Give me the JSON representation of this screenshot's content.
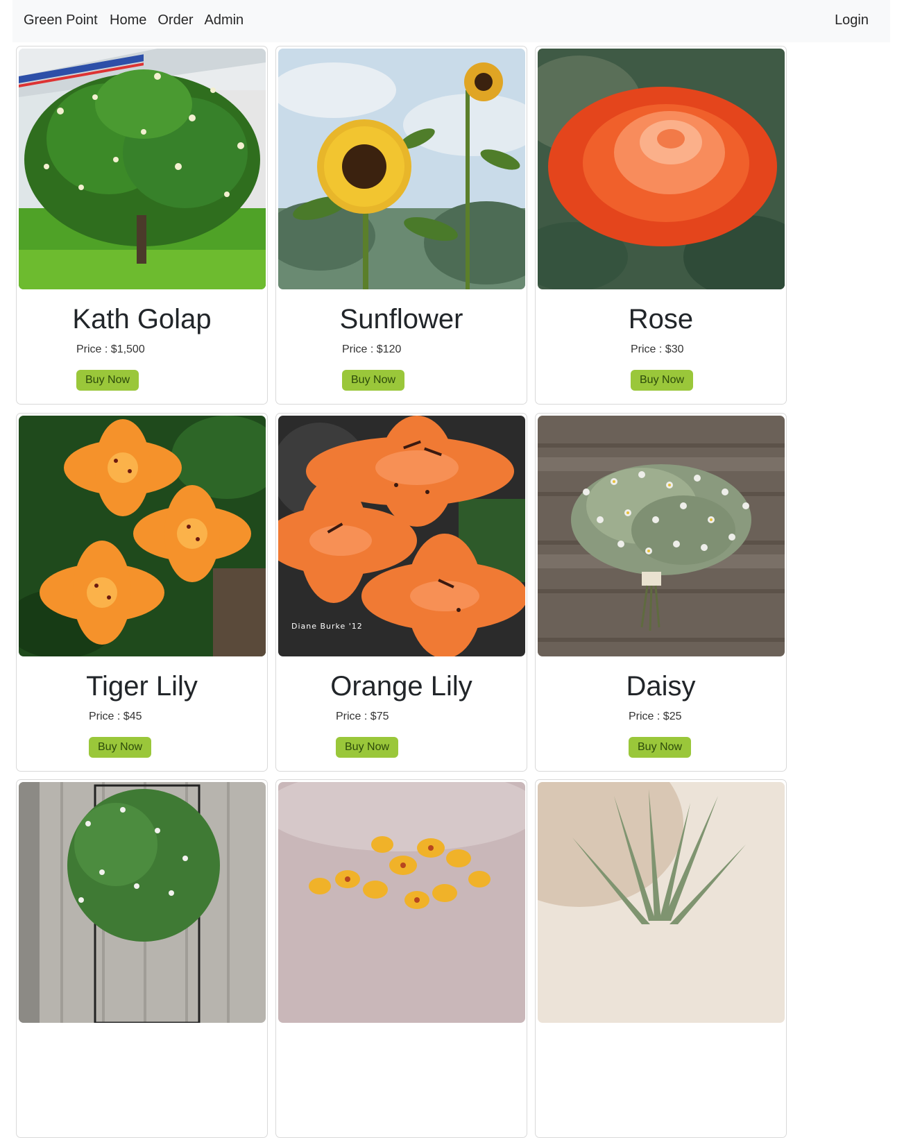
{
  "navbar": {
    "brand": "Green Point",
    "links": [
      "Home",
      "Order",
      "Admin"
    ],
    "login": "Login"
  },
  "products": [
    {
      "name": "Kath Golap",
      "price": "Price : $1,500",
      "button": "Buy Now"
    },
    {
      "name": "Sunflower",
      "price": "Price : $120",
      "button": "Buy Now"
    },
    {
      "name": "Rose",
      "price": "Price : $30",
      "button": "Buy Now"
    },
    {
      "name": "Tiger Lily",
      "price": "Price : $45",
      "button": "Buy Now"
    },
    {
      "name": "Orange Lily",
      "price": "Price : $75",
      "button": "Buy Now"
    },
    {
      "name": "Daisy",
      "price": "Price : $25",
      "button": "Buy Now"
    },
    {
      "name": "",
      "price": "",
      "button": ""
    },
    {
      "name": "",
      "price": "",
      "button": ""
    },
    {
      "name": "",
      "price": "",
      "button": ""
    }
  ],
  "images": {
    "orange_lily_watermark": "Diane Burke '12"
  },
  "colors": {
    "navbar_bg": "#f8f9fa",
    "button_bg": "#9ac73a",
    "card_border": "#d9d9d9"
  }
}
